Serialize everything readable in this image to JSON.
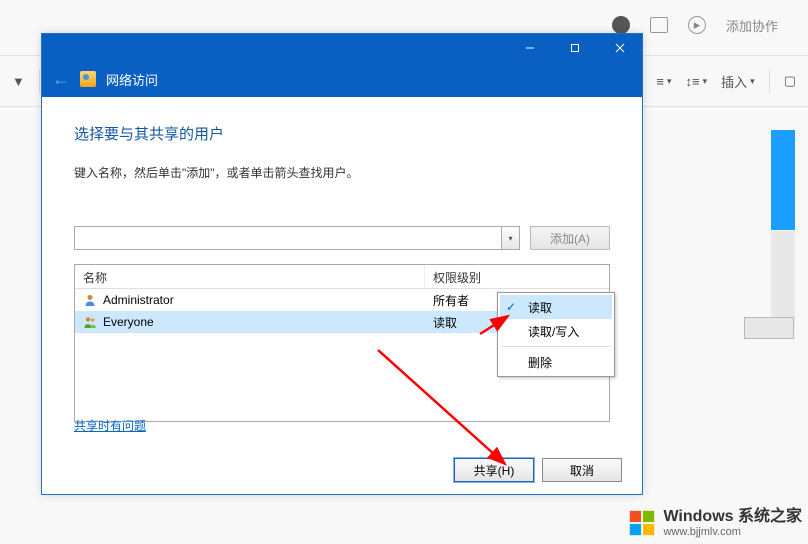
{
  "bg": {
    "toolbar_insert": "插入",
    "toolbar_collab": "添加协作"
  },
  "dialog": {
    "title": "网络访问",
    "heading": "选择要与其共享的用户",
    "instruction": "键入名称，然后单击\"添加\"，或者单击箭头查找用户。",
    "add_button": "添加(A)",
    "columns": {
      "name": "名称",
      "permission": "权限级别"
    },
    "rows": [
      {
        "name": "Administrator",
        "permission": "所有者",
        "dropdown": false
      },
      {
        "name": "Everyone",
        "permission": "读取",
        "dropdown": true,
        "selected": true
      }
    ],
    "help_link": "共享时有问题",
    "share_button": "共享(H)",
    "cancel_button": "取消"
  },
  "menu": {
    "items": [
      "读取",
      "读取/写入"
    ],
    "delete": "删除",
    "checked_index": 0
  },
  "watermark": {
    "main": "Windows 系统之家",
    "sub": "www.bjjmlv.com"
  }
}
